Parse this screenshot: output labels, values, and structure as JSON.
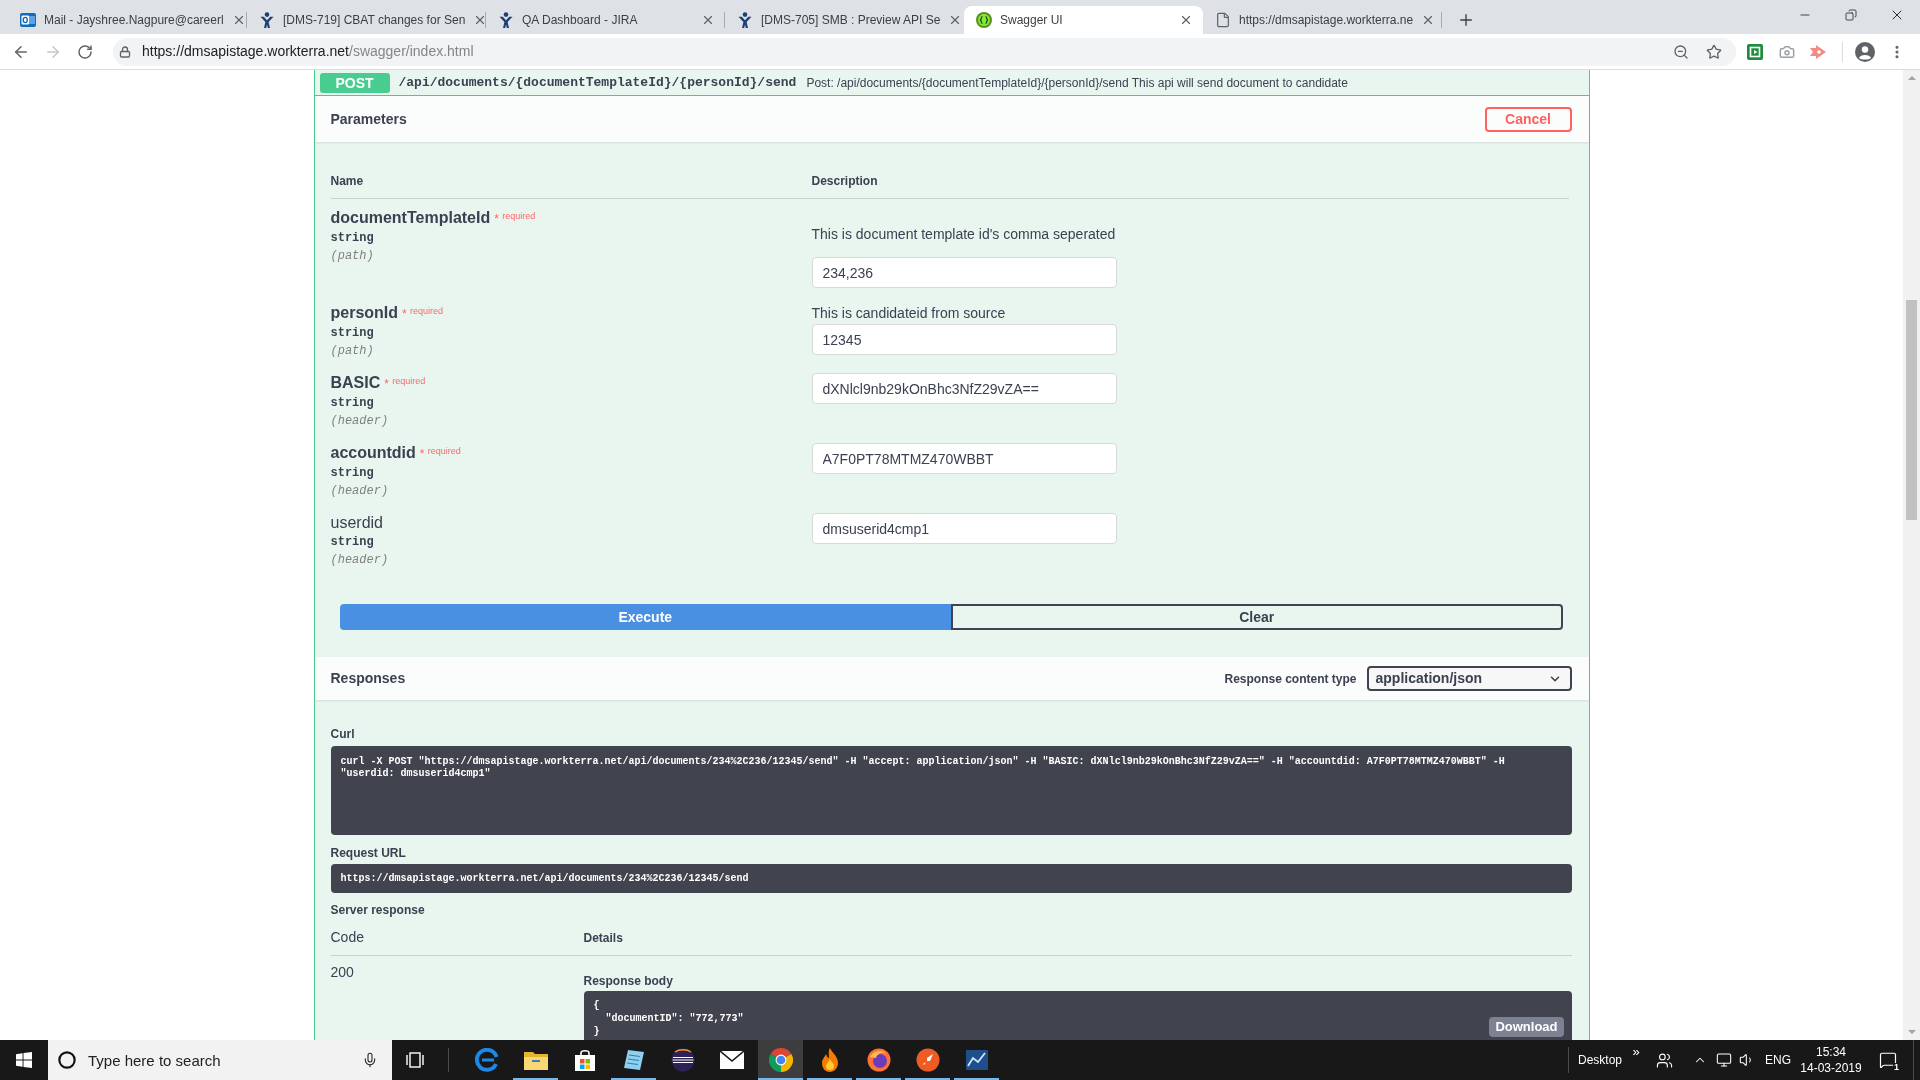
{
  "browser": {
    "tabs": [
      {
        "kind": "mail",
        "title": "Mail - Jayshree.Nagpure@careerl",
        "selected": false
      },
      {
        "kind": "figure",
        "title": "[DMS-719] CBAT changes for Sen",
        "selected": false
      },
      {
        "kind": "figure",
        "title": "QA Dashboard - JIRA",
        "selected": false
      },
      {
        "kind": "figure",
        "title": "[DMS-705] SMB : Preview API Se",
        "selected": false
      },
      {
        "kind": "emblem",
        "title": "Swagger UI",
        "selected": true
      },
      {
        "kind": "page",
        "title": "https://dmsapistage.workterra.ne",
        "selected": false
      }
    ],
    "back_enabled": true,
    "forward_enabled": false,
    "address": {
      "host": "https://dmsapistage.workterra.net",
      "path": "/swagger/index.html"
    }
  },
  "operation": {
    "method": "POST",
    "path": "/api/documents/{documentTemplateId}/{personId}/send",
    "summary": "Post: /api/documents/{documentTemplateId}/{personId}/send This api will send document to candidate",
    "parameters": {
      "title": "Parameters",
      "cancel": "Cancel",
      "columns": [
        "Name",
        "Description"
      ],
      "items": [
        {
          "name": "documentTemplateId",
          "required": true,
          "required_note": "* $^{required}$",
          "type": "string",
          "location": "(path)",
          "description": "This is document template id's comma seperated",
          "value": "234,236"
        },
        {
          "name": "personId",
          "required": true,
          "required_note": "* $^{required}$",
          "type": "string",
          "location": "(path)",
          "description": "This is candidateid from source",
          "value": "12345"
        },
        {
          "name": "BASIC",
          "required": true,
          "required_note": "* $^{required}$",
          "type": "string",
          "location": "(header)",
          "value": "dXNlcl9nb29kOnBhc3NfZ29vZA=="
        },
        {
          "name": "accountdid",
          "required": true,
          "required_note": "* $^{required}$",
          "type": "string",
          "location": "(header)",
          "value": "A7F0PT78MTMZ470WBBT"
        },
        {
          "name": "userdid",
          "required": false,
          "type": "string",
          "location": "(header)",
          "value": "dmsuserid4cmp1"
        }
      ]
    },
    "execute": "Execute",
    "clear": "Clear",
    "responses": {
      "title": "Responses",
      "content_type_label": "Response content type",
      "content_type": "application/json",
      "curl_label": "Curl",
      "curl": "curl -X POST \"https://dmsapistage.workterra.net/api/documents/234%2C236/12345/send\" -H \"accept: application/json\" -H \"BASIC: dXNlcl9nb29kOnBhc3NfZ29vZA==\" -H \"accountdid: A7F0PT78MTMZ470WBBT\" -H \"userdid: dmsuserid4cmp1\"",
      "request_url_label": "Request URL",
      "request_url": "https://dmsapistage.workterra.net/api/documents/234%2C236/12345/send",
      "server_response_label": "Server response",
      "columns": [
        "Code",
        "Details"
      ],
      "code": "200",
      "body_label": "Response body",
      "body": "{\n  \"documentID\": \"772,773\"\n}",
      "download": "Download"
    }
  },
  "taskbar": {
    "search_placeholder": "Type here to search",
    "apps": [
      {
        "kind": "swirl",
        "running": false,
        "selected": false
      },
      {
        "kind": "folder",
        "running": true,
        "selected": false
      },
      {
        "kind": "bag",
        "running": false,
        "selected": false
      },
      {
        "kind": "notebook",
        "running": true,
        "selected": false
      },
      {
        "kind": "stripes",
        "running": false,
        "selected": false
      },
      {
        "kind": "envelope",
        "running": false,
        "selected": false
      },
      {
        "kind": "segments",
        "running": true,
        "selected": true
      },
      {
        "kind": "flame",
        "running": true,
        "selected": false
      },
      {
        "kind": "orb",
        "running": true,
        "selected": false
      },
      {
        "kind": "rocket",
        "running": true,
        "selected": false
      },
      {
        "kind": "chart",
        "running": true,
        "selected": false
      }
    ],
    "toolbar_label": "Desktop",
    "toolbar_chevron": "»",
    "language": "ENG",
    "time": "15:34",
    "date": "14-03-2019",
    "notification_count": "1"
  }
}
